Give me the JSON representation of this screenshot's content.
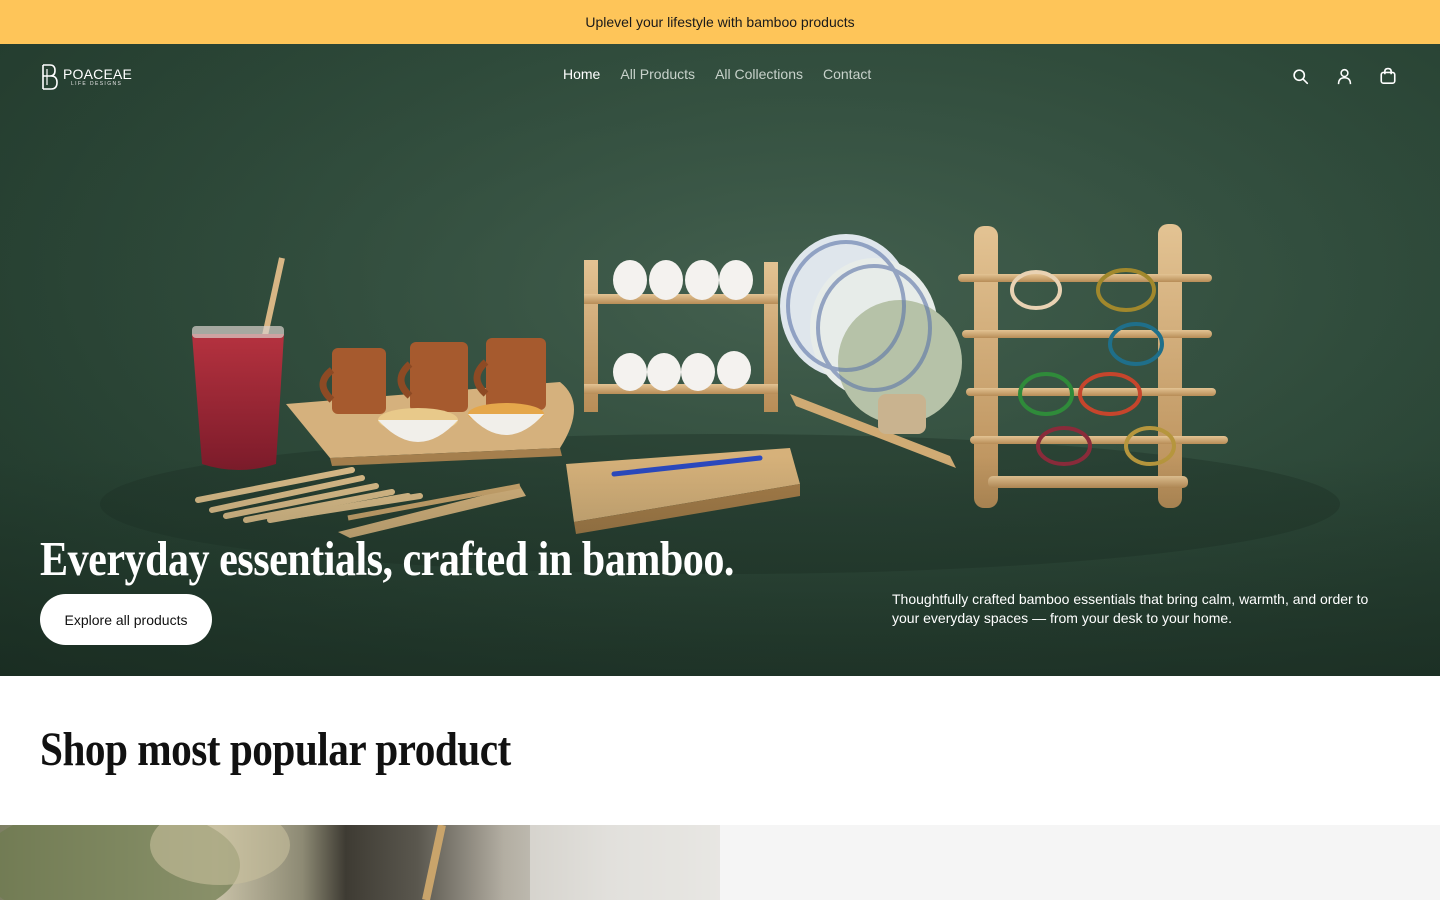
{
  "announcement": {
    "text": "Uplevel your lifestyle with bamboo products"
  },
  "brand": {
    "name": "POACEAE",
    "tagline": "LIFE DESIGNS",
    "logo_icon": "pb-monogram-icon"
  },
  "nav": {
    "items": [
      {
        "label": "Home",
        "active": true
      },
      {
        "label": "All Products",
        "active": false
      },
      {
        "label": "All Collections",
        "active": false
      },
      {
        "label": "Contact",
        "active": false
      }
    ],
    "icons": [
      "search-icon",
      "account-icon",
      "cart-icon"
    ]
  },
  "hero": {
    "headline": "Everyday essentials, crafted in bamboo.",
    "cta_label": "Explore all products",
    "description": "Thoughtfully crafted bamboo essentials that bring calm, warmth, and order to your everyday spaces — from your desk to your home."
  },
  "popular_section": {
    "title": "Shop most popular product"
  },
  "colors": {
    "announcement_bg": "#fec559",
    "hero_bg": "#2e4a3a",
    "accent_text": "#ffffff"
  }
}
